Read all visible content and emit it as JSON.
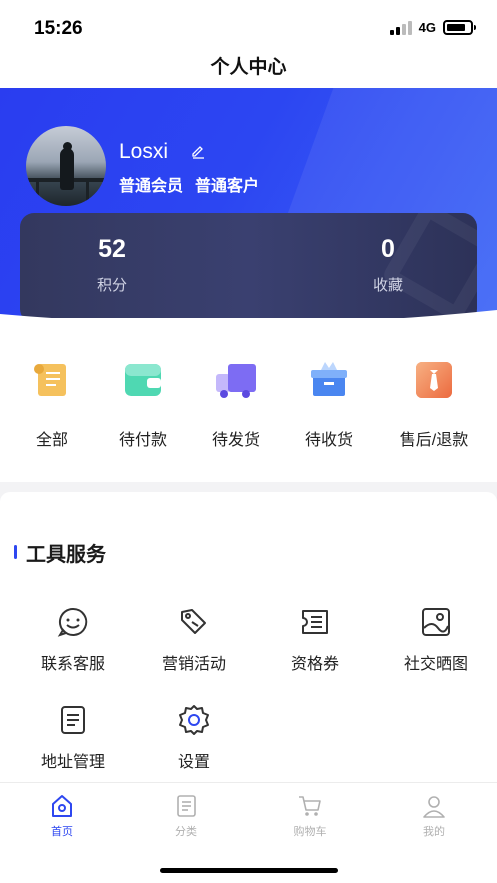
{
  "status_bar": {
    "time": "15:26",
    "network": "4G"
  },
  "page_title": "个人中心",
  "profile": {
    "username": "Losxi",
    "tags": [
      "普通会员",
      "普通客户"
    ]
  },
  "stats": [
    {
      "value": "52",
      "label": "积分"
    },
    {
      "value": "0",
      "label": "收藏"
    }
  ],
  "orders": [
    {
      "label": "全部",
      "icon": "scroll-icon"
    },
    {
      "label": "待付款",
      "icon": "wallet-icon"
    },
    {
      "label": "待发货",
      "icon": "truck-icon"
    },
    {
      "label": "待收货",
      "icon": "package-icon"
    },
    {
      "label": "售后/退款",
      "icon": "refund-icon"
    }
  ],
  "tools": {
    "title": "工具服务",
    "items": [
      {
        "label": "联系客服",
        "icon": "smile-chat-icon"
      },
      {
        "label": "营销活动",
        "icon": "tag-icon"
      },
      {
        "label": "资格券",
        "icon": "coupon-icon"
      },
      {
        "label": "社交晒图",
        "icon": "image-icon"
      },
      {
        "label": "地址管理",
        "icon": "document-icon"
      },
      {
        "label": "设置",
        "icon": "gear-icon"
      }
    ]
  },
  "tabbar": [
    {
      "label": "首页",
      "icon": "home-icon",
      "active": true
    },
    {
      "label": "分类",
      "icon": "list-icon",
      "active": false
    },
    {
      "label": "购物车",
      "icon": "cart-icon",
      "active": false
    },
    {
      "label": "我的",
      "icon": "user-icon",
      "active": false
    }
  ],
  "colors": {
    "accent": "#2e47f0",
    "header_start": "#2a3df0",
    "card": "#363b66"
  }
}
